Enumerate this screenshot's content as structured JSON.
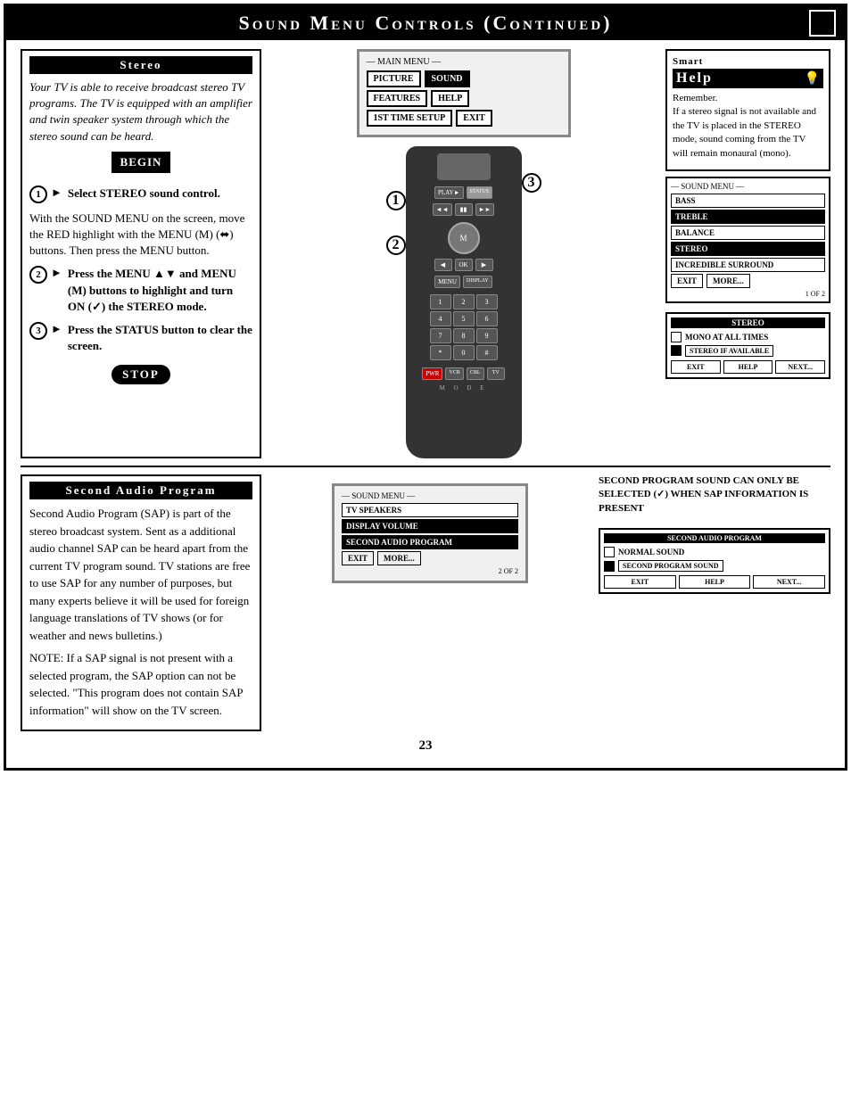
{
  "header": {
    "title": "Sound Menu Controls (Continued)",
    "page_number": "23"
  },
  "stereo_panel": {
    "title": "Stereo",
    "intro": "Your TV is able to receive broadcast stereo TV programs. The TV is equipped with an amplifier and twin speaker system through which the stereo sound can be heard.",
    "begin_label": "BEGIN",
    "step1": "Select STEREO sound control.",
    "step1_detail": "With the SOUND MENU on the screen, move the RED highlight with the MENU (M) (⬌) buttons. Then press the MENU button.",
    "step2": "Press the MENU ▲▼ and MENU (M) buttons to highlight and turn ON (✓) the STEREO mode.",
    "step3": "Press the STATUS button to clear the screen.",
    "stop_label": "STOP"
  },
  "smart_help": {
    "smart_label": "Smart",
    "help_label": "Help",
    "bulb_icon": "💡",
    "remember_text": "Remember.\nIf a stereo signal is not available and the TV is placed in the STEREO mode, sound coming from the TV will remain monaural (mono)."
  },
  "main_menu": {
    "label": "MAIN MENU",
    "items": [
      "PICTURE",
      "SOUND",
      "FEATURES",
      "HELP",
      "1ST TIME SETUP",
      "EXIT"
    ]
  },
  "sound_menu_right": {
    "label": "SOUND MENU",
    "items": [
      "BASS",
      "TREBLE",
      "BALANCE",
      "STEREO",
      "INCREDIBLE SURROUND"
    ],
    "exit_btn": "EXIT",
    "more_btn": "MORE...",
    "page_indicator": "1 OF 2"
  },
  "stereo_submenu": {
    "title": "STEREO",
    "option1": "MONO AT ALL TIMES",
    "option2": "STEREO IF AVAILABLE",
    "exit_btn": "EXIT",
    "help_btn": "HELP",
    "next_btn": "NEXT..."
  },
  "second_audio": {
    "title": "Second Audio Program",
    "text1": "Second Audio Program (SAP) is part of the stereo broadcast system. Sent as a additional audio channel SAP can be heard apart from the current TV program sound. TV stations are free to use SAP for any number of purposes, but many experts believe it will be used for foreign language translations of TV shows (or for weather and news bulletins.)",
    "text2": "NOTE: If a SAP signal is not present with a selected program, the SAP option can not be selected. \"This program does not contain SAP information\" will show on the TV screen."
  },
  "sound_menu_bottom": {
    "label": "SOUND MENU",
    "items": [
      "TV SPEAKERS",
      "DISPLAY VOLUME",
      "SECOND AUDIO PROGRAM"
    ],
    "exit_btn": "EXIT",
    "more_btn": "MORE...",
    "page_indicator": "2 OF 2"
  },
  "second_program_notice": "SECOND PROGRAM SOUND CAN ONLY BE SELECTED (✓) WHEN SAP INFORMATION IS PRESENT",
  "sap_submenu": {
    "title": "SECOND AUDIO PROGRAM",
    "option1": "NORMAL SOUND",
    "option2": "SECOND PROGRAM SOUND",
    "exit_btn": "EXIT",
    "help_btn": "HELP",
    "next_btn": "NEXT..."
  },
  "steps": {
    "step1_num": "1",
    "step2_num": "2",
    "step3_num": "3"
  }
}
